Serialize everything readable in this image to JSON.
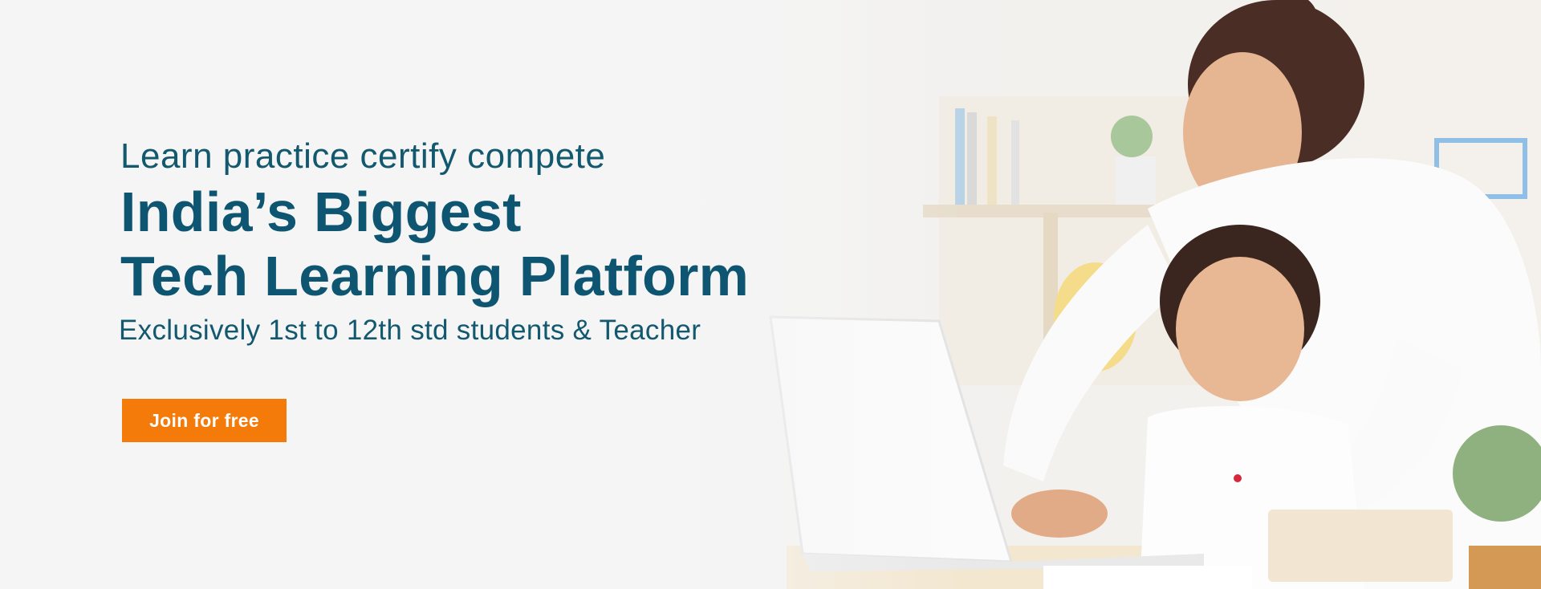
{
  "hero": {
    "tagline": "Learn practice certify compete",
    "headline_line1": "India’s Biggest",
    "headline_line2": "Tech Learning Platform",
    "subline": "Exclusively 1st to 12th std students & Teacher",
    "cta_label": "Join for free"
  },
  "colors": {
    "heading": "#0d5570",
    "cta_background": "#f47a0a",
    "cta_text": "#ffffff"
  }
}
